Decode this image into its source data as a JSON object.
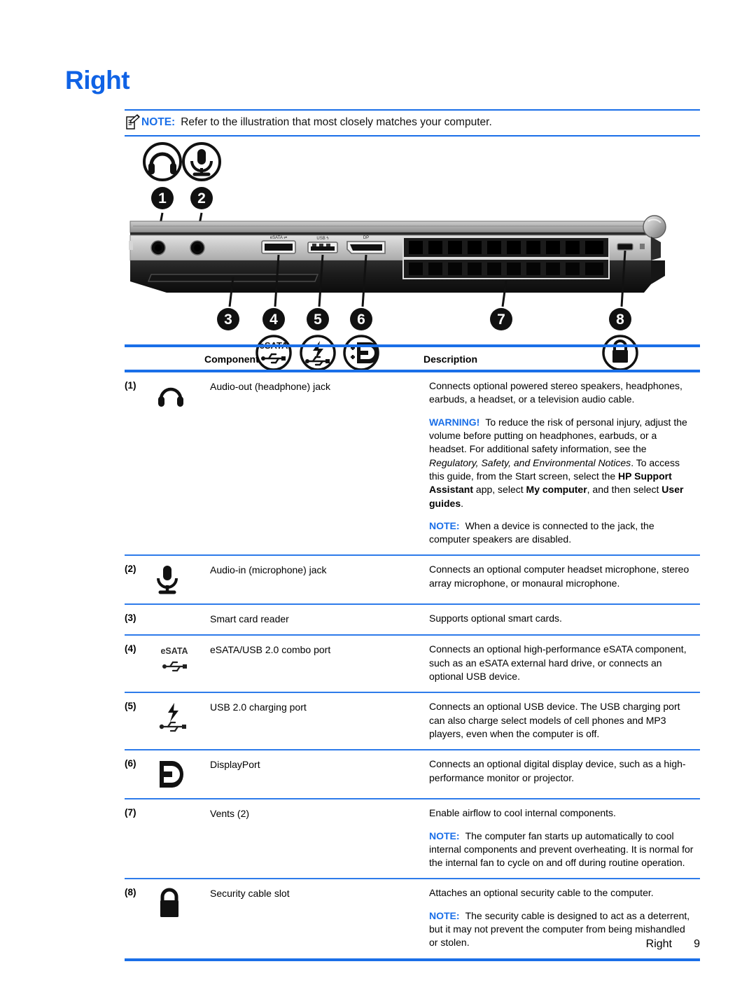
{
  "title": "Right",
  "colors": {
    "heading_blue": "#0F62E5",
    "rule_blue": "#1A6FE8",
    "separator_blue": "#2E7BEA",
    "text_black": "#000000"
  },
  "top_note": {
    "icon": "note-pad-icon",
    "keyword": "NOTE:",
    "text": "Refer to the illustration that most closely matches your computer."
  },
  "illustration": {
    "name": "laptop-right-side-view",
    "callouts": [
      "1",
      "2",
      "3",
      "4",
      "5",
      "6",
      "7",
      "8"
    ],
    "top_icons": [
      "headphone-icon",
      "microphone-icon"
    ],
    "bottom_icons": [
      "esata-usb-icon",
      "usb-charging-icon",
      "displayport-icon",
      "lock-icon"
    ],
    "esata_label": "eSATA"
  },
  "table": {
    "headers": {
      "component": "Component",
      "description": "Description"
    },
    "rows": [
      {
        "num": "(1)",
        "icon": "headphone-icon",
        "name": "Audio-out (headphone) jack",
        "desc_paragraphs": [
          {
            "kind": "plain",
            "text": "Connects optional powered stereo speakers, headphones, earbuds, a headset, or a television audio cable."
          },
          {
            "kind": "warning",
            "keyword": "WARNING!",
            "text": "To reduce the risk of personal injury, adjust the volume before putting on headphones, earbuds, or a headset. For additional safety information, see the Regulatory, Safety, and Environmental Notices. To access this guide, from the Start screen, select the HP Support Assistant app, select My computer, and then select User guides.",
            "italic_phrase": "Regulatory, Safety, and Environmental Notices",
            "bold_phrases": [
              "HP Support Assistant",
              "My computer",
              "User guides"
            ]
          },
          {
            "kind": "note",
            "keyword": "NOTE:",
            "text": "When a device is connected to the jack, the computer speakers are disabled."
          }
        ]
      },
      {
        "num": "(2)",
        "icon": "microphone-icon",
        "name": "Audio-in (microphone) jack",
        "desc_paragraphs": [
          {
            "kind": "plain",
            "text": "Connects an optional computer headset microphone, stereo array microphone, or monaural microphone."
          }
        ]
      },
      {
        "num": "(3)",
        "icon": "none",
        "name": "Smart card reader",
        "desc_paragraphs": [
          {
            "kind": "plain",
            "text": "Supports optional smart cards."
          }
        ]
      },
      {
        "num": "(4)",
        "icon": "esata-usb-icon",
        "name": "eSATA/USB 2.0 combo port",
        "desc_paragraphs": [
          {
            "kind": "plain",
            "text": "Connects an optional high-performance eSATA component, such as an eSATA external hard drive, or connects an optional USB device."
          }
        ]
      },
      {
        "num": "(5)",
        "icon": "usb-charging-icon",
        "name": "USB 2.0 charging port",
        "desc_paragraphs": [
          {
            "kind": "plain",
            "text": "Connects an optional USB device. The USB charging port can also charge select models of cell phones and MP3 players, even when the computer is off."
          }
        ]
      },
      {
        "num": "(6)",
        "icon": "displayport-icon",
        "name": "DisplayPort",
        "desc_paragraphs": [
          {
            "kind": "plain",
            "text": "Connects an optional digital display device, such as a high-performance monitor or projector."
          }
        ]
      },
      {
        "num": "(7)",
        "icon": "none",
        "name": "Vents (2)",
        "desc_paragraphs": [
          {
            "kind": "plain",
            "text": "Enable airflow to cool internal components."
          },
          {
            "kind": "note",
            "keyword": "NOTE:",
            "text": "The computer fan starts up automatically to cool internal components and prevent overheating. It is normal for the internal fan to cycle on and off during routine operation."
          }
        ]
      },
      {
        "num": "(8)",
        "icon": "lock-icon",
        "name": "Security cable slot",
        "desc_paragraphs": [
          {
            "kind": "plain",
            "text": "Attaches an optional security cable to the computer."
          },
          {
            "kind": "note",
            "keyword": "NOTE:",
            "text": "The security cable is designed to act as a deterrent, but it may not prevent the computer from being mishandled or stolen."
          }
        ]
      }
    ]
  },
  "footer": {
    "label": "Right",
    "page": "9"
  },
  "rich_text": {
    "r1_p1": "Connects optional powered stereo speakers, headphones, earbuds, a headset, or a television audio cable.",
    "r1_warn_kw": "WARNING!",
    "r1_warn_a": "To reduce the risk of personal injury, adjust the volume before putting on headphones, earbuds, or a headset. For additional safety information, see the ",
    "r1_warn_ital": "Regulatory, Safety, and Environmental Notices",
    "r1_warn_b": ". To access this guide, from the Start screen, select the ",
    "r1_warn_bold1": "HP Support Assistant",
    "r1_warn_c": " app, select ",
    "r1_warn_bold2": "My computer",
    "r1_warn_d": ", and then select ",
    "r1_warn_bold3": "User guides",
    "r1_warn_e": ".",
    "r1_note_kw": "NOTE:",
    "r1_note_text": "When a device is connected to the jack, the computer speakers are disabled.",
    "r2_p1": "Connects an optional computer headset microphone, stereo array microphone, or monaural microphone.",
    "r3_p1": "Supports optional smart cards.",
    "r4_p1": "Connects an optional high-performance eSATA component, such as an eSATA external hard drive, or connects an optional USB device.",
    "r5_p1": "Connects an optional USB device. The USB charging port can also charge select models of cell phones and MP3 players, even when the computer is off.",
    "r6_p1": "Connects an optional digital display device, such as a high-performance monitor or projector.",
    "r7_p1": "Enable airflow to cool internal components.",
    "r7_note_kw": "NOTE:",
    "r7_note_text": "The computer fan starts up automatically to cool internal components and prevent overheating. It is normal for the internal fan to cycle on and off during routine operation.",
    "r8_p1": "Attaches an optional security cable to the computer.",
    "r8_note_kw": "NOTE:",
    "r8_note_text": "The security cable is designed to act as a deterrent, but it may not prevent the computer from being mishandled or stolen."
  }
}
